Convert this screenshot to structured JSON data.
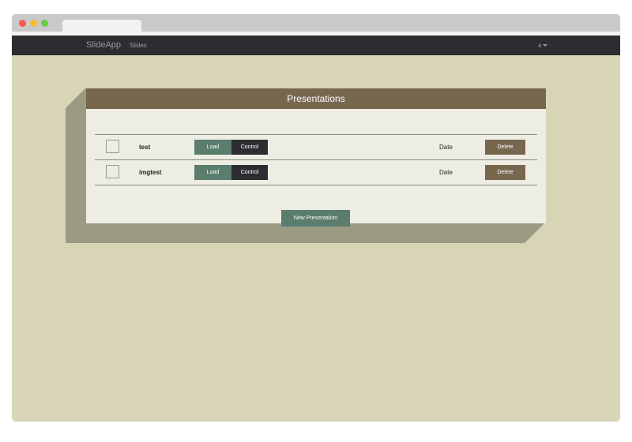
{
  "colors": {
    "background": "#d7d5b6",
    "navbar": "#2c2d31",
    "panel_header": "#77674f",
    "panel_body": "#eeede3",
    "accent_green": "#5a7d6e",
    "dark_button": "#2c2d31",
    "delete_button": "#77674f"
  },
  "navbar": {
    "brand": "SlideApp",
    "links": [
      "Slides"
    ],
    "user": "a"
  },
  "panel": {
    "title": "Presentations",
    "new_button_label": "New Presentation"
  },
  "presentations": [
    {
      "name": "test",
      "load_label": "Load",
      "control_label": "Control",
      "date_label": "Date",
      "delete_label": "Delete"
    },
    {
      "name": "imgtest",
      "load_label": "Load",
      "control_label": "Control",
      "date_label": "Date",
      "delete_label": "Delete"
    }
  ]
}
